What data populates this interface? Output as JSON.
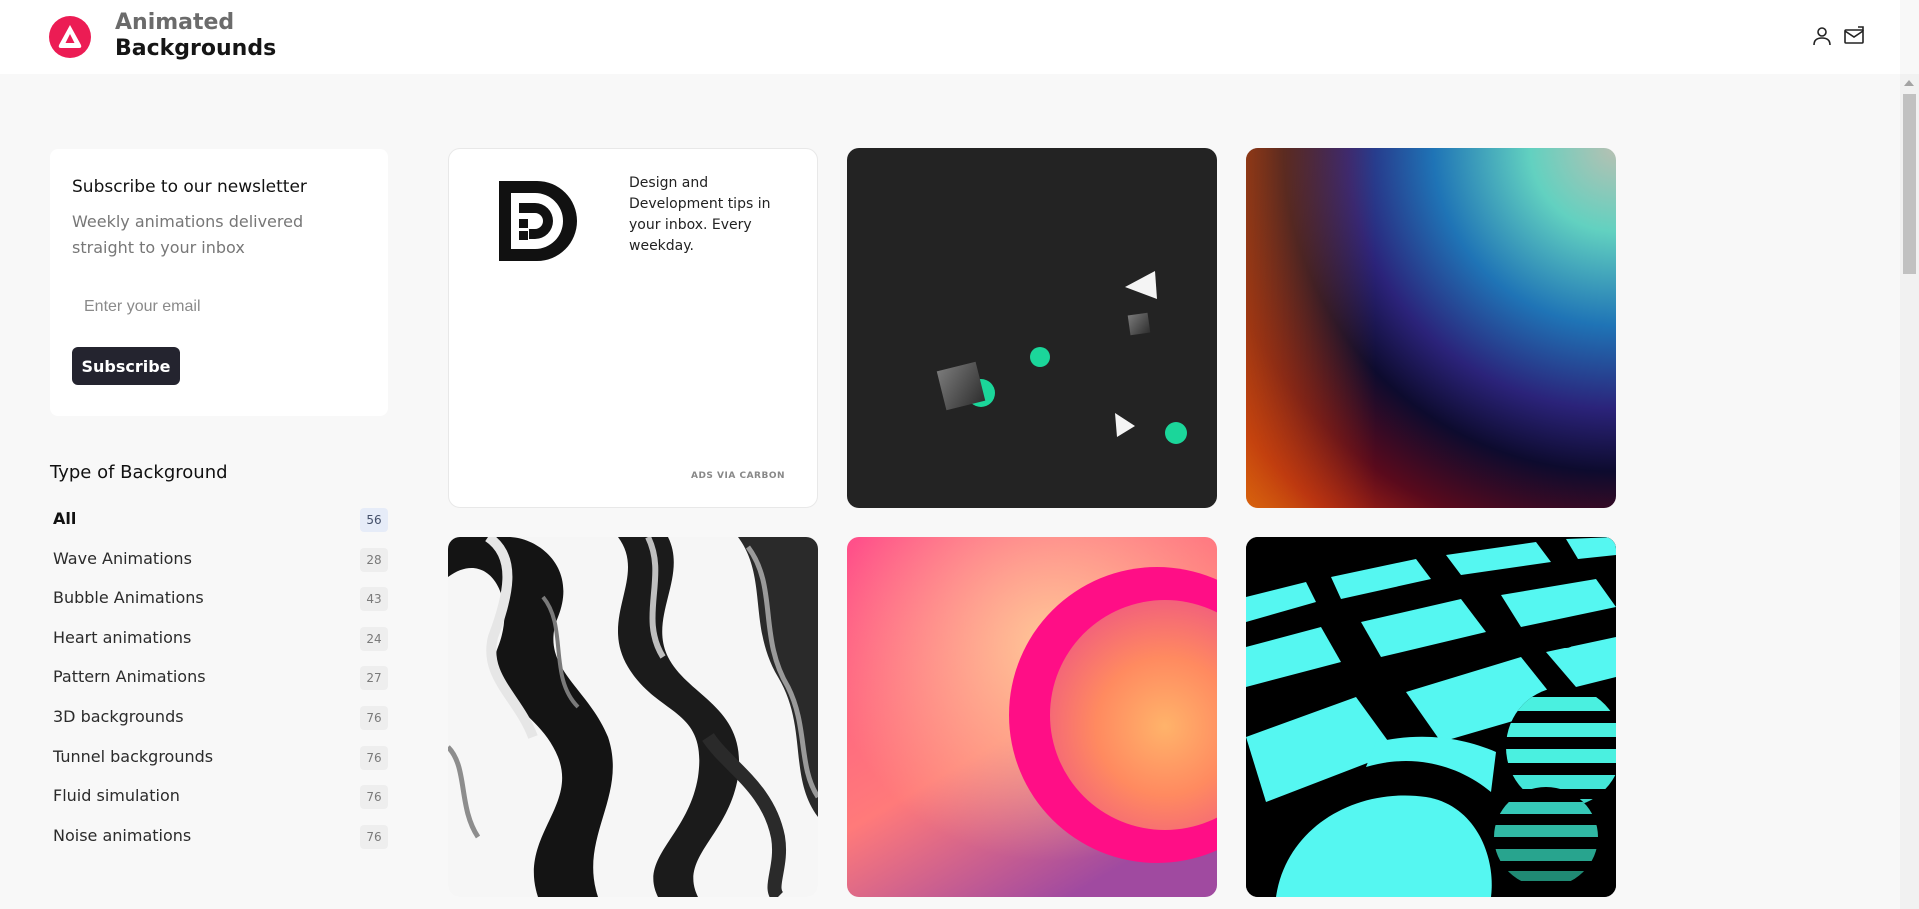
{
  "header": {
    "brand_line1": "Animated",
    "brand_line2": "Backgrounds",
    "logo_icon": "animated-backgrounds-logo",
    "brand_color": "#ec1c54",
    "user_icon": "user-icon",
    "mail_icon": "mail-icon"
  },
  "newsletter": {
    "title": "Subscribe to our newsletter",
    "subtitle": "Weekly animations delivered straight to your inbox",
    "email_placeholder": "Enter your email",
    "email_value": "",
    "button_label": "Subscribe"
  },
  "filters": {
    "title": "Type of Background",
    "items": [
      {
        "label": "All",
        "count": "56",
        "active": true
      },
      {
        "label": "Wave Animations",
        "count": "28"
      },
      {
        "label": "Bubble Animations",
        "count": "43"
      },
      {
        "label": "Heart animations",
        "count": "24"
      },
      {
        "label": "Pattern Animations",
        "count": "27"
      },
      {
        "label": "3D backgrounds",
        "count": "76"
      },
      {
        "label": "Tunnel backgrounds",
        "count": "76"
      },
      {
        "label": "Fluid simulation",
        "count": "76"
      },
      {
        "label": "Noise animations",
        "count": "76"
      }
    ]
  },
  "ad": {
    "text": "Design and Development tips in your inbox. Every weekday.",
    "via": "ADS VIA CARBON",
    "logo_icon": "dd-logo"
  },
  "gallery": {
    "items": [
      {
        "kind": "dark-shapes-animation"
      },
      {
        "kind": "gradient-rainbow-animation"
      },
      {
        "kind": "liquid-marble-animation"
      },
      {
        "kind": "pink-ring-animation"
      },
      {
        "kind": "checker-sphere-animation"
      }
    ]
  }
}
